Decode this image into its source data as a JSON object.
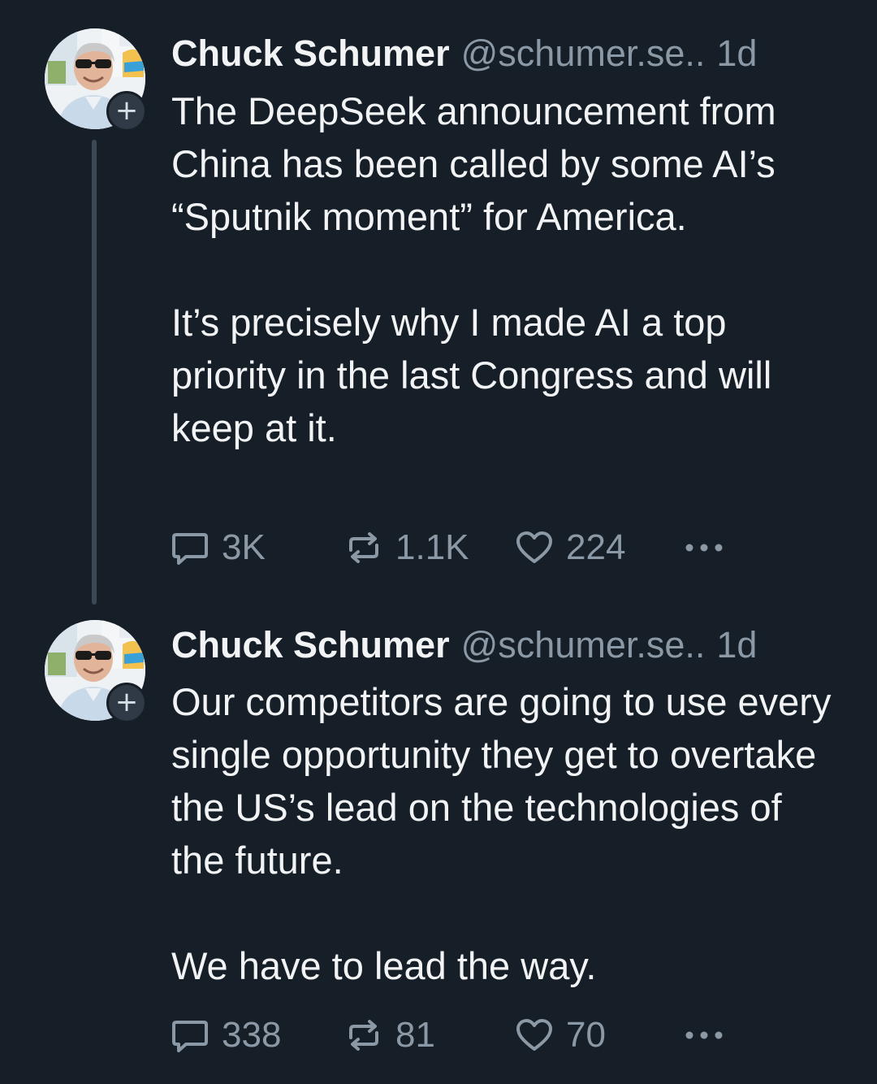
{
  "posts": [
    {
      "author_name": "Chuck Schumer",
      "handle": "@schumer.se..",
      "time": "1d",
      "follow_symbol": "+",
      "text": "The DeepSeek announcement from China has been called by some AI’s “Sputnik moment” for America.\n\nIt’s precisely why I made AI a top priority in the last Congress and will keep at it.",
      "replies": "3K",
      "reposts": "1.1K",
      "likes": "224",
      "more_icon": "more-horizontal-icon"
    },
    {
      "author_name": "Chuck Schumer",
      "handle": "@schumer.se..",
      "time": "1d",
      "follow_symbol": "+",
      "text": "Our competitors are going to use every single opportunity they get to overtake the US’s lead on the technologies of the future.\n\nWe have to lead the way.",
      "replies": "338",
      "reposts": "81",
      "likes": "70",
      "more_icon": "more-horizontal-icon"
    }
  ],
  "colors": {
    "background": "#161e27",
    "text": "#f1f3f5",
    "muted": "#8b98a5",
    "thread_line": "#3b4856"
  }
}
